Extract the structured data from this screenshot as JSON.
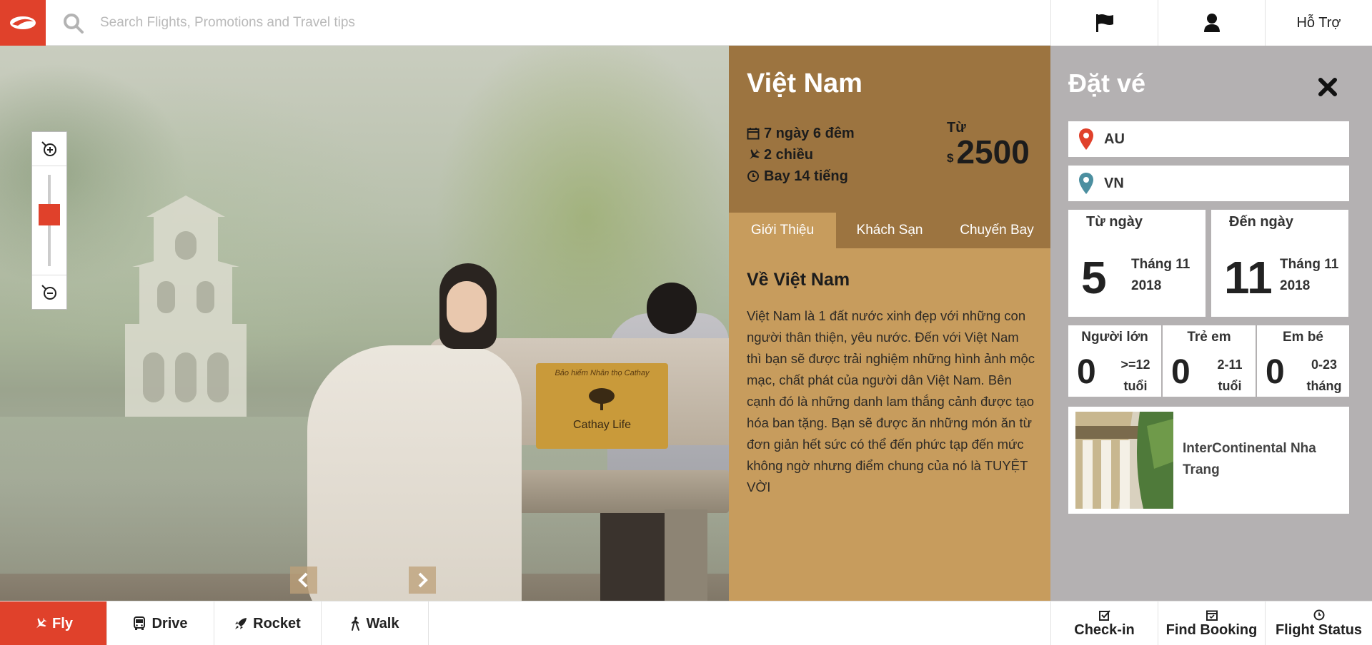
{
  "header": {
    "search_placeholder": "Search Flights, Promotions and Travel tips",
    "help_label": "Hỗ Trợ",
    "brand_color": "#e0412b"
  },
  "destination": {
    "title": "Việt Nam",
    "duration": "7 ngày 6 đêm",
    "trip_type": "2 chiều",
    "flight_time": "Bay 14 tiếng",
    "price_prefix": "Từ",
    "currency": "$",
    "price": "2500",
    "tabs": [
      {
        "label": "Giới Thiệu",
        "active": true
      },
      {
        "label": "Khách Sạn",
        "active": false
      },
      {
        "label": "Chuyến Bay",
        "active": false
      }
    ],
    "about_title": "Về Việt Nam",
    "about_text": "Việt Nam là 1 đất nước xinh đẹp với những con người thân thiện, yêu nước. Đến với Việt Nam thì bạn sẽ được trải nghiệm những hình ảnh mộc mạc, chất phát của người dân Việt Nam. Bên cạnh đó là những danh lam thắng cảnh được tạo hóa ban tặng. Bạn sẽ được ăn những món ăn từ đơn giản hết sức có thể đến phức tạp đến mức không ngờ nhưng điểm chung của nó là TUYỆT VỜI"
  },
  "booking": {
    "title": "Đặt vé",
    "from_code": "AU",
    "to_code": "VN",
    "date_from": {
      "label": "Từ ngày",
      "day": "5",
      "month": "Tháng 11",
      "year": "2018"
    },
    "date_to": {
      "label": "Đến ngày",
      "day": "11",
      "month": "Tháng 11",
      "year": "2018"
    },
    "passengers": [
      {
        "label": "Người lớn",
        "count": "0",
        "range_1": ">=12",
        "range_2": "tuổi"
      },
      {
        "label": "Trẻ em",
        "count": "0",
        "range_1": "2-11",
        "range_2": "tuổi"
      },
      {
        "label": "Em bé",
        "count": "0",
        "range_1": "0-23",
        "range_2": "tháng"
      }
    ],
    "hotel_name": "InterContinental Nha Trang"
  },
  "photo": {
    "bench_sign_line1": "Bảo hiểm Nhân thọ Cathay",
    "bench_sign_line2": "Cathay Life"
  },
  "map_zoom": {
    "level": 0.58
  },
  "modes": [
    {
      "label": "Fly",
      "icon": "plane-icon",
      "active": true
    },
    {
      "label": "Drive",
      "icon": "bus-icon",
      "active": false
    },
    {
      "label": "Rocket",
      "icon": "rocket-icon",
      "active": false
    },
    {
      "label": "Walk",
      "icon": "walk-icon",
      "active": false
    }
  ],
  "actions": [
    {
      "label": "Check-in",
      "icon": "check-square-icon"
    },
    {
      "label": "Find Booking",
      "icon": "calendar-check-icon"
    },
    {
      "label": "Flight Status",
      "icon": "clock-icon"
    }
  ]
}
